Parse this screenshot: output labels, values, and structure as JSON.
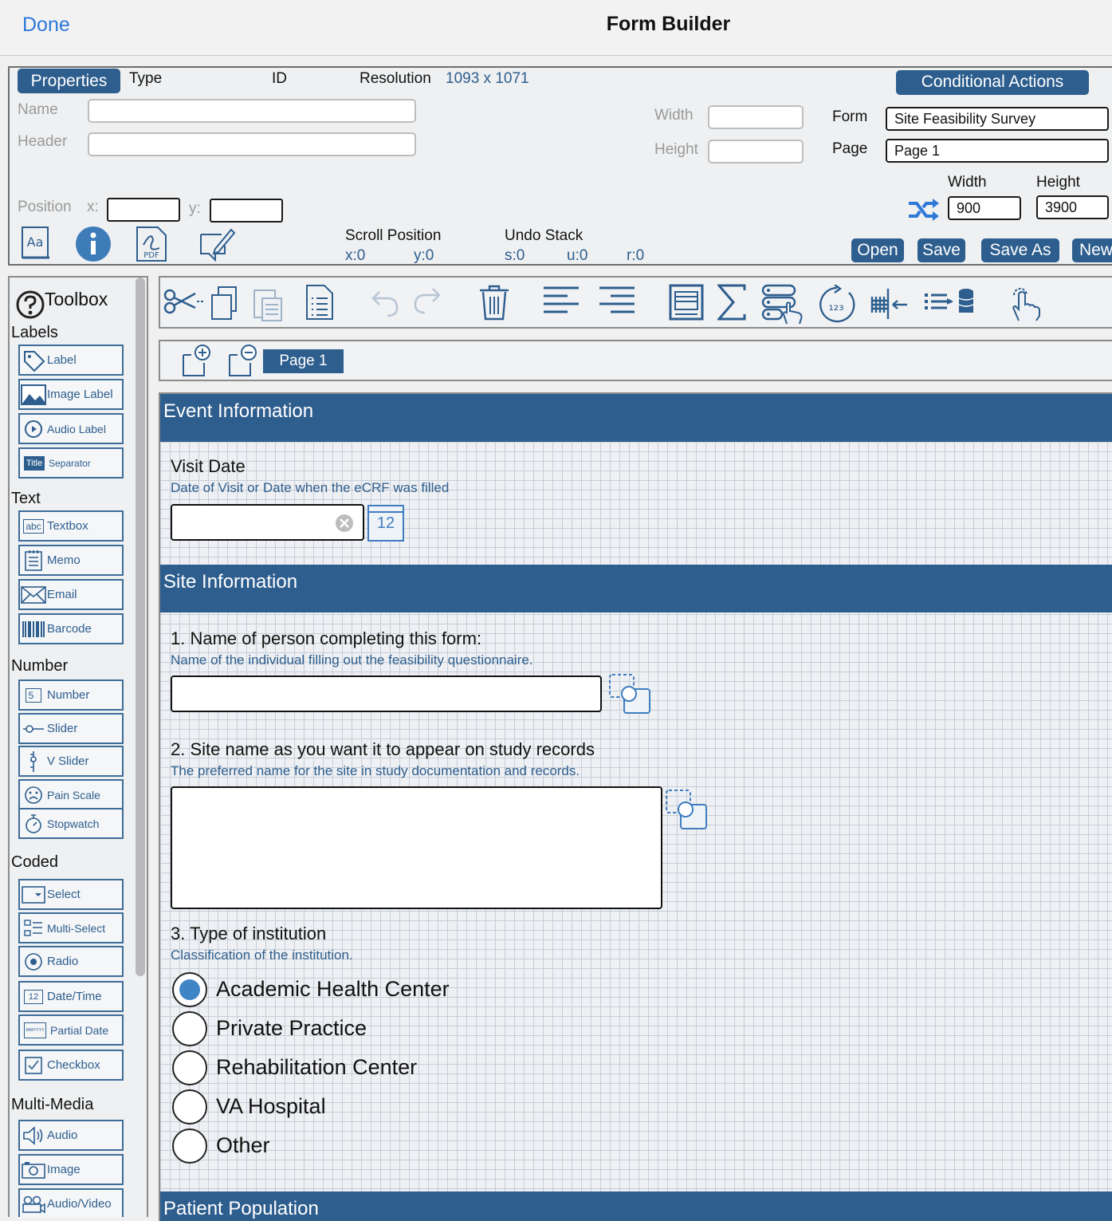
{
  "nav": {
    "done_label": "Done",
    "title": "Form Builder"
  },
  "properties": {
    "tab_label": "Properties",
    "type_label": "Type",
    "id_label": "ID",
    "resolution_label": "Resolution",
    "resolution_value": "1093 x 1071",
    "name_label": "Name",
    "header_label": "Header",
    "width_label": "Width",
    "height_label": "Height",
    "position_label": "Position",
    "x_label": "x:",
    "y_label": "y:",
    "conditional_actions_label": "Conditional Actions",
    "form_label": "Form",
    "form_value": "Site Feasibility Survey",
    "page_label": "Page",
    "page_value": "Page 1",
    "page_width_label": "Width",
    "page_height_label": "Height",
    "page_width_value": "900",
    "page_height_value": "3900",
    "scroll_position_label": "Scroll Position",
    "scroll_x": "x:0",
    "scroll_y": "y:0",
    "undo_stack_label": "Undo Stack",
    "undo_s": "s:0",
    "undo_u": "u:0",
    "undo_r": "r:0",
    "open_label": "Open",
    "save_label": "Save",
    "save_as_label": "Save As",
    "new_label": "New",
    "icon_pdf_text": "PDF",
    "icon_font_text": "Aa"
  },
  "toolbox": {
    "title": "Toolbox",
    "sections": {
      "labels": "Labels",
      "text": "Text",
      "number": "Number",
      "coded": "Coded",
      "multimedia": "Multi-Media"
    },
    "items": {
      "label": "Label",
      "image_label": "Image Label",
      "audio_label": "Audio Label",
      "separator": "Separator",
      "separator_badge": "Title",
      "textbox": "Textbox",
      "textbox_badge": "abc",
      "memo": "Memo",
      "email": "Email",
      "barcode": "Barcode",
      "number": "Number",
      "number_badge": "5",
      "slider": "Slider",
      "v_slider": "V Slider",
      "pain_scale": "Pain Scale",
      "stopwatch": "Stopwatch",
      "select": "Select",
      "multi_select": "Multi-Select",
      "radio": "Radio",
      "date_time": "Date/Time",
      "date_time_badge": "12",
      "partial_date": "Partial Date",
      "partial_date_badge": "MM/YYYY",
      "checkbox": "Checkbox",
      "audio": "Audio",
      "image": "Image",
      "audio_video": "Audio/Video"
    }
  },
  "pages": {
    "current_tab": "Page 1"
  },
  "canvas": {
    "sections": {
      "event": "Event Information",
      "site": "Site Information",
      "patient": "Patient Population"
    },
    "visit_date": {
      "title": "Visit Date",
      "subtitle": "Date of Visit or Date when the eCRF was filled",
      "calendar_day": "12"
    },
    "q1": {
      "title": "1. Name of person completing this form:",
      "subtitle": "Name of the individual filling out the feasibility questionnaire."
    },
    "q2": {
      "title": "2. Site name as you want it to appear on study records",
      "subtitle": "The preferred name for the site in study documentation and records."
    },
    "q3": {
      "title": "3. Type of institution",
      "subtitle": "Classification of the institution.",
      "options": [
        "Academic Health Center",
        "Private Practice",
        "Rehabilitation Center",
        "VA Hospital",
        "Other"
      ],
      "selected": "Academic Health Center"
    }
  },
  "colors": {
    "accent": "#2e5e8e",
    "link": "#2e78d7",
    "radio_fill": "#3f85c6"
  }
}
